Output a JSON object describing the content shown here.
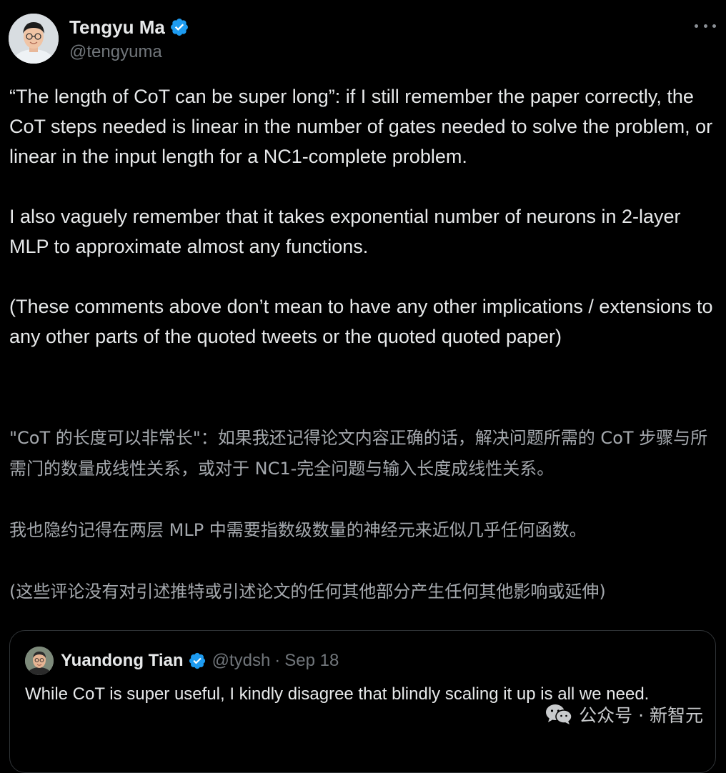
{
  "tweet": {
    "author": {
      "name": "Tengyu Ma",
      "handle": "@tengyuma"
    },
    "paragraphs": [
      "“The length of CoT can be super long”: if I still remember the paper correctly, the CoT steps needed is linear in the number of gates needed to solve the problem, or linear in the input length for a NC1-complete problem.",
      "I also vaguely remember that it takes exponential number of neurons in 2-layer MLP to approximate almost any functions.",
      "(These comments above don’t mean to have any other implications / extensions to any other parts of the quoted tweets or the quoted quoted paper)"
    ],
    "translation": [
      "\"CoT 的长度可以非常长\"：如果我还记得论文内容正确的话，解决问题所需的 CoT 步骤与所需门的数量成线性关系，或对于 NC1-完全问题与输入长度成线性关系。",
      "我也隐约记得在两层 MLP 中需要指数级数量的神经元来近似几乎任何函数。",
      "(这些评论没有对引述推特或引述论文的任何其他部分产生任何其他影响或延伸)"
    ]
  },
  "quoted_tweet": {
    "name": "Yuandong Tian",
    "handle": "@tydsh",
    "separator": "·",
    "date": "Sep 18",
    "text": "While CoT is super useful, I kindly disagree that blindly scaling it up is all we need."
  },
  "watermark": {
    "label": "公众号 · 新智元",
    "icon": "wechat-icon"
  },
  "colors": {
    "background": "#000000",
    "text": "#e7e9ea",
    "secondary": "#71767b",
    "verified": "#1d9bf0",
    "border": "#2f3336"
  }
}
